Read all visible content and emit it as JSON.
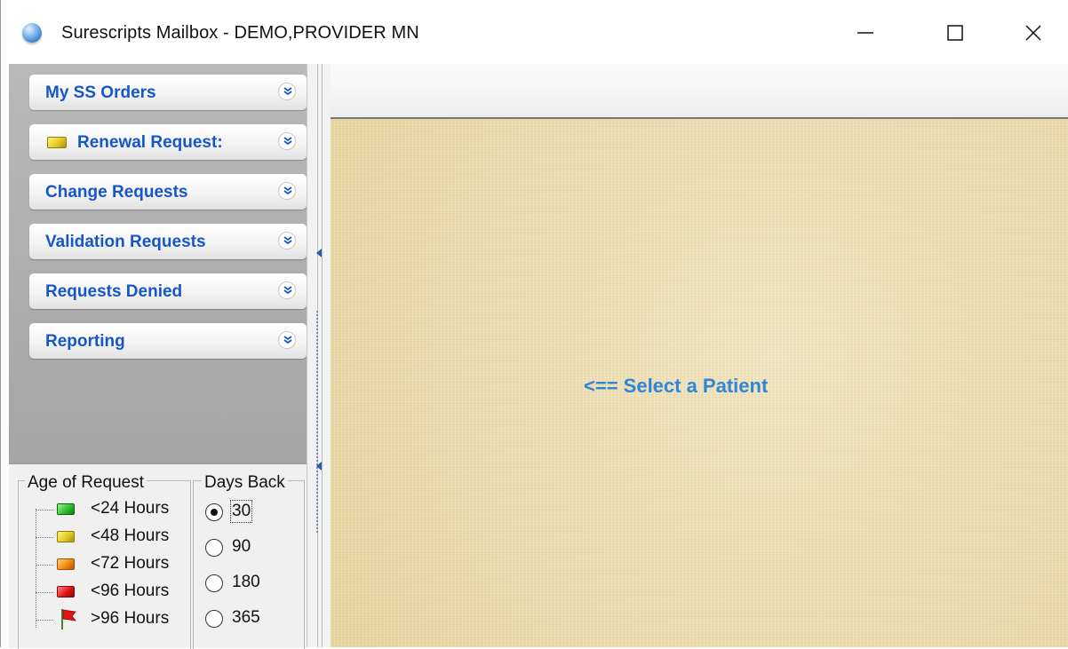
{
  "window": {
    "title": "Surescripts Mailbox - DEMO,PROVIDER MN",
    "icon": "surescripts-globe-icon"
  },
  "sidebar": {
    "items": [
      {
        "label": "My SS Orders",
        "indicator": null
      },
      {
        "label": "Renewal Request:",
        "indicator": "yellow"
      },
      {
        "label": "Change Requests",
        "indicator": null
      },
      {
        "label": "Validation Requests",
        "indicator": null
      },
      {
        "label": "Requests Denied",
        "indicator": null
      },
      {
        "label": "Reporting",
        "indicator": null
      }
    ]
  },
  "legend": {
    "title": "Age of Request",
    "items": [
      {
        "label": "<24 Hours",
        "color": "#2fc12f",
        "icon": "green-indicator-icon"
      },
      {
        "label": "<48 Hours",
        "color": "#e3cb1f",
        "icon": "yellow-indicator-icon"
      },
      {
        "label": "<72 Hours",
        "color": "#f58a16",
        "icon": "orange-indicator-icon"
      },
      {
        "label": "<96 Hours",
        "color": "#e01414",
        "icon": "red-indicator-icon"
      },
      {
        "label": ">96 Hours",
        "color": "#e01414",
        "icon": "red-flag-icon"
      }
    ]
  },
  "days_back": {
    "title": "Days Back",
    "options": [
      "30",
      "90",
      "180",
      "365"
    ],
    "selected": "30"
  },
  "main": {
    "prompt": "<== Select a Patient"
  },
  "colors": {
    "accent_blue": "#1557c8",
    "prompt_blue": "#2f86d8",
    "content_bg": "#eddca8"
  }
}
